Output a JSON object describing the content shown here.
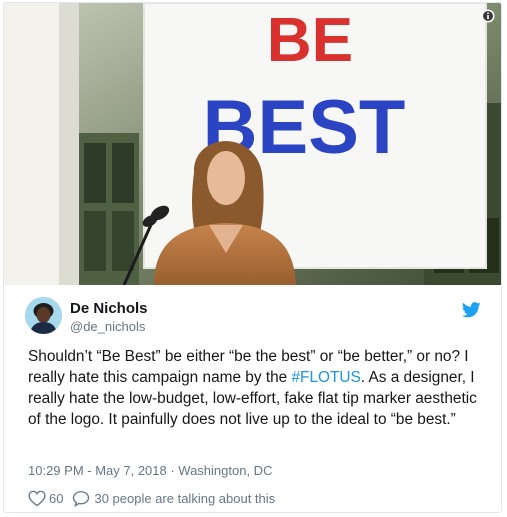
{
  "tweet": {
    "photo": {
      "sign_line1": "BE",
      "sign_line2": "BEST",
      "sign_line1_color": "#d8312e",
      "sign_line2_color": "#2a44c4"
    },
    "author": {
      "name": "De Nichols",
      "handle": "@de_nichols"
    },
    "text_before_hashtag": "Shouldn’t “Be Best” be either “be the best” or “be better,” or no? I really hate this campaign name by the ",
    "hashtag": "#FLOTUS",
    "text_after_hashtag": ". As a designer, I really hate the low-budget, low-effort, fake flat tip marker aesthetic of the logo. It painfully does not live up to the ideal to “be best.”",
    "timestamp": "10:29 PM - May 7, 2018 · Washington, DC",
    "likes": "60",
    "talking": "30 people are talking about this",
    "colors": {
      "link": "#1b95e0",
      "muted": "#657786",
      "twitter_blue": "#1da1f2"
    },
    "icons": [
      "info-icon",
      "twitter-bird-icon",
      "heart-icon",
      "reply-bubble-icon"
    ]
  }
}
